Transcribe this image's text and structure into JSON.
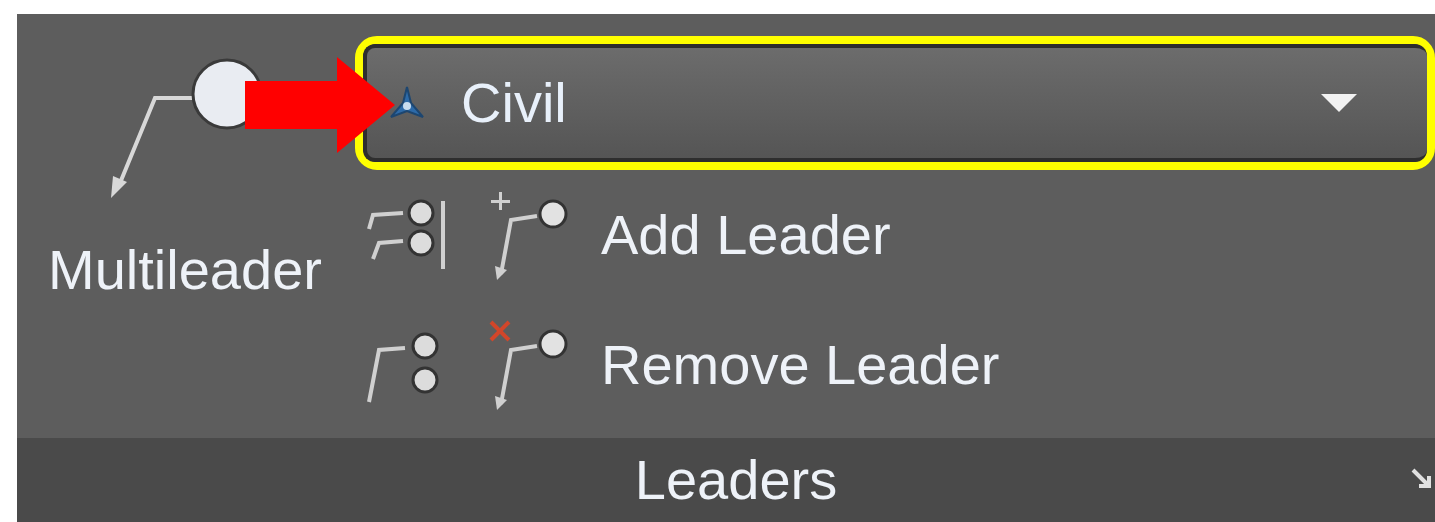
{
  "panel": {
    "title": "Leaders"
  },
  "big_button": {
    "label": "Multileader"
  },
  "style_dropdown": {
    "value": "Civil"
  },
  "rows": [
    {
      "kind": "add",
      "label": "Add Leader"
    },
    {
      "kind": "remove",
      "label": "Remove Leader"
    }
  ]
}
